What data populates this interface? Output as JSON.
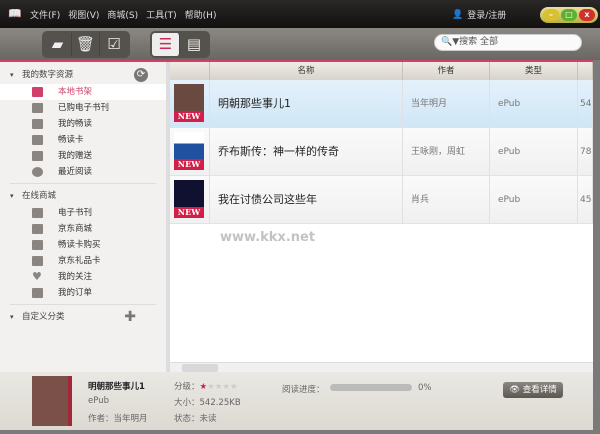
{
  "menu": [
    "文件(F)",
    "视图(V)",
    "商城(S)",
    "工具(T)",
    "帮助(H)"
  ],
  "login": "登录/注册",
  "search": {
    "placeholder": "▼搜索 全部"
  },
  "sidebar": {
    "sections": [
      {
        "label": "我的数字资源",
        "items": [
          "本地书架",
          "已购电子书刊",
          "我的畅读",
          "畅读卡",
          "我的赠送",
          "最近阅读"
        ]
      },
      {
        "label": "在线商城",
        "items": [
          "电子书刊",
          "京东商城",
          "畅读卡购买",
          "京东礼品卡",
          "我的关注",
          "我的订单"
        ]
      },
      {
        "label": "自定义分类",
        "items": []
      }
    ]
  },
  "table": {
    "headers": [
      "名称",
      "作者",
      "类型"
    ],
    "rows": [
      {
        "title": "明朝那些事儿1",
        "author": "当年明月",
        "type": "ePub",
        "size": "54",
        "badge": "NEW"
      },
      {
        "title": "乔布斯传：神一样的传奇",
        "author": "王咏刚，周虹",
        "type": "ePub",
        "size": "78",
        "badge": "NEW"
      },
      {
        "title": "我在讨债公司这些年",
        "author": "肖兵",
        "type": "ePub",
        "size": "45",
        "badge": "NEW"
      }
    ]
  },
  "watermark": "www.kkx.net",
  "details": {
    "title": "明朝那些事儿1",
    "format": "ePub",
    "author": "作者：当年明月",
    "rating_label": "分级：",
    "rating": 1,
    "rating_max": 5,
    "size": "大小：542.25KB",
    "status": "状态：未读",
    "progress_label": "阅读进度：",
    "progress": "0%",
    "view_button": "查看详情"
  },
  "colors": {
    "accent": "#d0406a"
  }
}
